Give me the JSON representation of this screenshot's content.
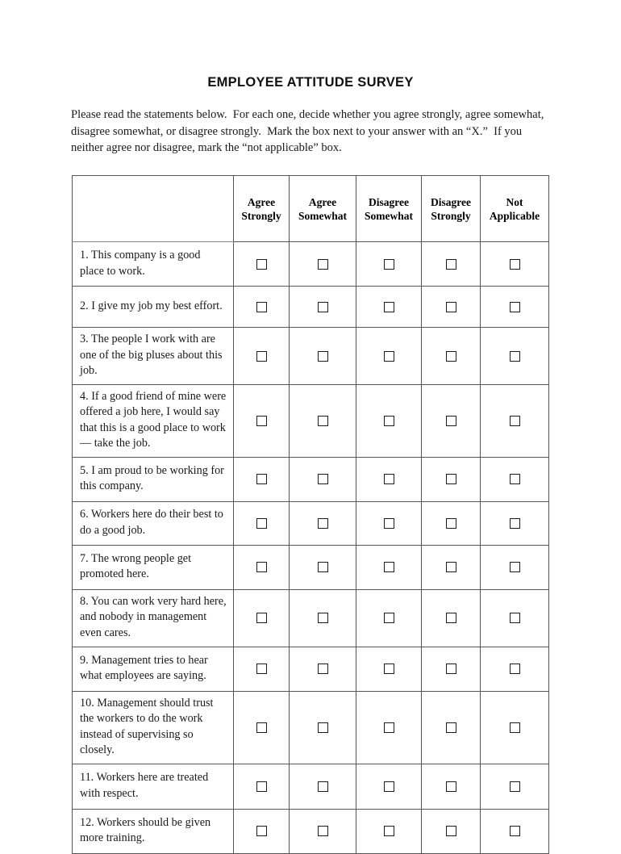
{
  "document": {
    "title": "EMPLOYEE ATTITUDE SURVEY",
    "instructions": "Please read the statements below.  For each one, decide whether you agree strongly, agree somewhat, disagree somewhat, or disagree strongly.  Mark the box next to your answer with an “X.”  If you neither agree nor disagree, mark the “not applicable” box."
  },
  "table": {
    "blank_header": "",
    "columns": [
      {
        "line1": "Agree",
        "line2": "Strongly"
      },
      {
        "line1": "Agree",
        "line2": "Somewhat"
      },
      {
        "line1": "Disagree",
        "line2": "Somewhat"
      },
      {
        "line1": "Disagree",
        "line2": "Strongly"
      },
      {
        "line1": "Not",
        "line2": "Applicable"
      }
    ],
    "rows": [
      {
        "statement": "1. This company is a good place to work."
      },
      {
        "statement": "2. I give my job my best effort."
      },
      {
        "statement": "3. The people I work with are one of the big pluses about this job."
      },
      {
        "statement": "4. If a good friend of mine were offered a job here, I would say that this is a good place to work — take the job."
      },
      {
        "statement": "5. I am proud to be working for this company."
      },
      {
        "statement": "6. Workers here do their best to do a good job."
      },
      {
        "statement": "7.  The wrong people get promoted here."
      },
      {
        "statement": "8. You can work very hard here, and nobody in management even cares."
      },
      {
        "statement": "9. Management tries to hear what employees are saying."
      },
      {
        "statement": "10. Management should trust the workers to do the work instead of supervising so closely."
      },
      {
        "statement": "11. Workers here are treated with respect."
      },
      {
        "statement": "12. Workers should be given more training."
      }
    ],
    "checkbox_state": "unchecked"
  },
  "colors": {
    "page_background": "#ffffff",
    "text": "#1a1a1a",
    "border": "#555555",
    "checkbox_border": "#1c1c1c"
  }
}
